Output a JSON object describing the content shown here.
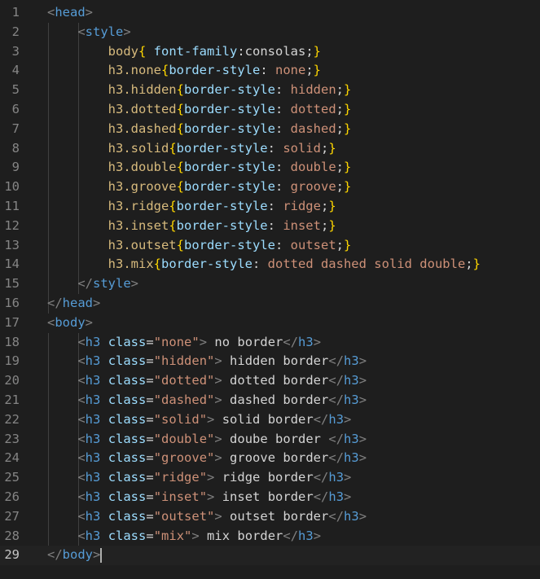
{
  "editor": {
    "lines": [
      {
        "n": "1",
        "parts": [
          [
            "punct",
            "<"
          ],
          [
            "tag",
            "head"
          ],
          [
            "punct",
            ">"
          ]
        ]
      },
      {
        "n": "2",
        "parts": [
          [
            "txt",
            "    "
          ],
          [
            "punct",
            "<"
          ],
          [
            "tag",
            "style"
          ],
          [
            "punct",
            ">"
          ]
        ]
      },
      {
        "n": "3",
        "parts": [
          [
            "txt",
            "        "
          ],
          [
            "sel",
            "body"
          ],
          [
            "brace",
            "{"
          ],
          [
            "txt",
            " "
          ],
          [
            "prop",
            "font-family"
          ],
          [
            "txt",
            ":consolas;"
          ],
          [
            "brace",
            "}"
          ]
        ]
      },
      {
        "n": "4",
        "parts": [
          [
            "txt",
            "        "
          ],
          [
            "sel",
            "h3.none"
          ],
          [
            "brace",
            "{"
          ],
          [
            "prop",
            "border-style"
          ],
          [
            "txt",
            ": "
          ],
          [
            "val",
            "none"
          ],
          [
            "txt",
            ";"
          ],
          [
            "brace",
            "}"
          ]
        ]
      },
      {
        "n": "5",
        "parts": [
          [
            "txt",
            "        "
          ],
          [
            "sel",
            "h3.hidden"
          ],
          [
            "brace",
            "{"
          ],
          [
            "prop",
            "border-style"
          ],
          [
            "txt",
            ": "
          ],
          [
            "val",
            "hidden"
          ],
          [
            "txt",
            ";"
          ],
          [
            "brace",
            "}"
          ]
        ]
      },
      {
        "n": "6",
        "parts": [
          [
            "txt",
            "        "
          ],
          [
            "sel",
            "h3.dotted"
          ],
          [
            "brace",
            "{"
          ],
          [
            "prop",
            "border-style"
          ],
          [
            "txt",
            ": "
          ],
          [
            "val",
            "dotted"
          ],
          [
            "txt",
            ";"
          ],
          [
            "brace",
            "}"
          ]
        ]
      },
      {
        "n": "7",
        "parts": [
          [
            "txt",
            "        "
          ],
          [
            "sel",
            "h3.dashed"
          ],
          [
            "brace",
            "{"
          ],
          [
            "prop",
            "border-style"
          ],
          [
            "txt",
            ": "
          ],
          [
            "val",
            "dashed"
          ],
          [
            "txt",
            ";"
          ],
          [
            "brace",
            "}"
          ]
        ]
      },
      {
        "n": "8",
        "parts": [
          [
            "txt",
            "        "
          ],
          [
            "sel",
            "h3.solid"
          ],
          [
            "brace",
            "{"
          ],
          [
            "prop",
            "border-style"
          ],
          [
            "txt",
            ": "
          ],
          [
            "val",
            "solid"
          ],
          [
            "txt",
            ";"
          ],
          [
            "brace",
            "}"
          ]
        ]
      },
      {
        "n": "9",
        "parts": [
          [
            "txt",
            "        "
          ],
          [
            "sel",
            "h3.double"
          ],
          [
            "brace",
            "{"
          ],
          [
            "prop",
            "border-style"
          ],
          [
            "txt",
            ": "
          ],
          [
            "val",
            "double"
          ],
          [
            "txt",
            ";"
          ],
          [
            "brace",
            "}"
          ]
        ]
      },
      {
        "n": "10",
        "parts": [
          [
            "txt",
            "        "
          ],
          [
            "sel",
            "h3.groove"
          ],
          [
            "brace",
            "{"
          ],
          [
            "prop",
            "border-style"
          ],
          [
            "txt",
            ": "
          ],
          [
            "val",
            "groove"
          ],
          [
            "txt",
            ";"
          ],
          [
            "brace",
            "}"
          ]
        ]
      },
      {
        "n": "11",
        "parts": [
          [
            "txt",
            "        "
          ],
          [
            "sel",
            "h3.ridge"
          ],
          [
            "brace",
            "{"
          ],
          [
            "prop",
            "border-style"
          ],
          [
            "txt",
            ": "
          ],
          [
            "val",
            "ridge"
          ],
          [
            "txt",
            ";"
          ],
          [
            "brace",
            "}"
          ]
        ]
      },
      {
        "n": "12",
        "parts": [
          [
            "txt",
            "        "
          ],
          [
            "sel",
            "h3.inset"
          ],
          [
            "brace",
            "{"
          ],
          [
            "prop",
            "border-style"
          ],
          [
            "txt",
            ": "
          ],
          [
            "val",
            "inset"
          ],
          [
            "txt",
            ";"
          ],
          [
            "brace",
            "}"
          ]
        ]
      },
      {
        "n": "13",
        "parts": [
          [
            "txt",
            "        "
          ],
          [
            "sel",
            "h3.outset"
          ],
          [
            "brace",
            "{"
          ],
          [
            "prop",
            "border-style"
          ],
          [
            "txt",
            ": "
          ],
          [
            "val",
            "outset"
          ],
          [
            "txt",
            ";"
          ],
          [
            "brace",
            "}"
          ]
        ]
      },
      {
        "n": "14",
        "parts": [
          [
            "txt",
            "        "
          ],
          [
            "sel",
            "h3.mix"
          ],
          [
            "brace",
            "{"
          ],
          [
            "prop",
            "border-style"
          ],
          [
            "txt",
            ": "
          ],
          [
            "val",
            "dotted dashed solid double"
          ],
          [
            "txt",
            ";"
          ],
          [
            "brace",
            "}"
          ]
        ]
      },
      {
        "n": "15",
        "parts": [
          [
            "txt",
            "    "
          ],
          [
            "punct",
            "</"
          ],
          [
            "tag",
            "style"
          ],
          [
            "punct",
            ">"
          ]
        ]
      },
      {
        "n": "16",
        "parts": [
          [
            "punct",
            "</"
          ],
          [
            "tag",
            "head"
          ],
          [
            "punct",
            ">"
          ]
        ]
      },
      {
        "n": "17",
        "parts": [
          [
            "punct",
            "<"
          ],
          [
            "tag",
            "body"
          ],
          [
            "punct",
            ">"
          ]
        ]
      },
      {
        "n": "18",
        "parts": [
          [
            "txt",
            "    "
          ],
          [
            "punct",
            "<"
          ],
          [
            "tag",
            "h3"
          ],
          [
            "txt",
            " "
          ],
          [
            "attr",
            "class"
          ],
          [
            "txt",
            "="
          ],
          [
            "str",
            "\"none\""
          ],
          [
            "punct",
            ">"
          ],
          [
            "txt",
            " no border"
          ],
          [
            "punct",
            "</"
          ],
          [
            "tag",
            "h3"
          ],
          [
            "punct",
            ">"
          ]
        ]
      },
      {
        "n": "19",
        "parts": [
          [
            "txt",
            "    "
          ],
          [
            "punct",
            "<"
          ],
          [
            "tag",
            "h3"
          ],
          [
            "txt",
            " "
          ],
          [
            "attr",
            "class"
          ],
          [
            "txt",
            "="
          ],
          [
            "str",
            "\"hidden\""
          ],
          [
            "punct",
            ">"
          ],
          [
            "txt",
            " hidden border"
          ],
          [
            "punct",
            "</"
          ],
          [
            "tag",
            "h3"
          ],
          [
            "punct",
            ">"
          ]
        ]
      },
      {
        "n": "20",
        "parts": [
          [
            "txt",
            "    "
          ],
          [
            "punct",
            "<"
          ],
          [
            "tag",
            "h3"
          ],
          [
            "txt",
            " "
          ],
          [
            "attr",
            "class"
          ],
          [
            "txt",
            "="
          ],
          [
            "str",
            "\"dotted\""
          ],
          [
            "punct",
            ">"
          ],
          [
            "txt",
            " dotted border"
          ],
          [
            "punct",
            "</"
          ],
          [
            "tag",
            "h3"
          ],
          [
            "punct",
            ">"
          ]
        ]
      },
      {
        "n": "21",
        "parts": [
          [
            "txt",
            "    "
          ],
          [
            "punct",
            "<"
          ],
          [
            "tag",
            "h3"
          ],
          [
            "txt",
            " "
          ],
          [
            "attr",
            "class"
          ],
          [
            "txt",
            "="
          ],
          [
            "str",
            "\"dashed\""
          ],
          [
            "punct",
            ">"
          ],
          [
            "txt",
            " dashed border"
          ],
          [
            "punct",
            "</"
          ],
          [
            "tag",
            "h3"
          ],
          [
            "punct",
            ">"
          ]
        ]
      },
      {
        "n": "22",
        "parts": [
          [
            "txt",
            "    "
          ],
          [
            "punct",
            "<"
          ],
          [
            "tag",
            "h3"
          ],
          [
            "txt",
            " "
          ],
          [
            "attr",
            "class"
          ],
          [
            "txt",
            "="
          ],
          [
            "str",
            "\"solid\""
          ],
          [
            "punct",
            ">"
          ],
          [
            "txt",
            " solid border"
          ],
          [
            "punct",
            "</"
          ],
          [
            "tag",
            "h3"
          ],
          [
            "punct",
            ">"
          ]
        ]
      },
      {
        "n": "23",
        "parts": [
          [
            "txt",
            "    "
          ],
          [
            "punct",
            "<"
          ],
          [
            "tag",
            "h3"
          ],
          [
            "txt",
            " "
          ],
          [
            "attr",
            "class"
          ],
          [
            "txt",
            "="
          ],
          [
            "str",
            "\"double\""
          ],
          [
            "punct",
            ">"
          ],
          [
            "txt",
            " doube border "
          ],
          [
            "punct",
            "</"
          ],
          [
            "tag",
            "h3"
          ],
          [
            "punct",
            ">"
          ]
        ]
      },
      {
        "n": "24",
        "parts": [
          [
            "txt",
            "    "
          ],
          [
            "punct",
            "<"
          ],
          [
            "tag",
            "h3"
          ],
          [
            "txt",
            " "
          ],
          [
            "attr",
            "class"
          ],
          [
            "txt",
            "="
          ],
          [
            "str",
            "\"groove\""
          ],
          [
            "punct",
            ">"
          ],
          [
            "txt",
            " groove border"
          ],
          [
            "punct",
            "</"
          ],
          [
            "tag",
            "h3"
          ],
          [
            "punct",
            ">"
          ]
        ]
      },
      {
        "n": "25",
        "parts": [
          [
            "txt",
            "    "
          ],
          [
            "punct",
            "<"
          ],
          [
            "tag",
            "h3"
          ],
          [
            "txt",
            " "
          ],
          [
            "attr",
            "class"
          ],
          [
            "txt",
            "="
          ],
          [
            "str",
            "\"ridge\""
          ],
          [
            "punct",
            ">"
          ],
          [
            "txt",
            " ridge border"
          ],
          [
            "punct",
            "</"
          ],
          [
            "tag",
            "h3"
          ],
          [
            "punct",
            ">"
          ]
        ]
      },
      {
        "n": "26",
        "parts": [
          [
            "txt",
            "    "
          ],
          [
            "punct",
            "<"
          ],
          [
            "tag",
            "h3"
          ],
          [
            "txt",
            " "
          ],
          [
            "attr",
            "class"
          ],
          [
            "txt",
            "="
          ],
          [
            "str",
            "\"inset\""
          ],
          [
            "punct",
            ">"
          ],
          [
            "txt",
            " inset border"
          ],
          [
            "punct",
            "</"
          ],
          [
            "tag",
            "h3"
          ],
          [
            "punct",
            ">"
          ]
        ]
      },
      {
        "n": "27",
        "parts": [
          [
            "txt",
            "    "
          ],
          [
            "punct",
            "<"
          ],
          [
            "tag",
            "h3"
          ],
          [
            "txt",
            " "
          ],
          [
            "attr",
            "class"
          ],
          [
            "txt",
            "="
          ],
          [
            "str",
            "\"outset\""
          ],
          [
            "punct",
            ">"
          ],
          [
            "txt",
            " outset border"
          ],
          [
            "punct",
            "</"
          ],
          [
            "tag",
            "h3"
          ],
          [
            "punct",
            ">"
          ]
        ]
      },
      {
        "n": "28",
        "parts": [
          [
            "txt",
            "    "
          ],
          [
            "punct",
            "<"
          ],
          [
            "tag",
            "h3"
          ],
          [
            "txt",
            " "
          ],
          [
            "attr",
            "class"
          ],
          [
            "txt",
            "="
          ],
          [
            "str",
            "\"mix\""
          ],
          [
            "punct",
            ">"
          ],
          [
            "txt",
            " mix border"
          ],
          [
            "punct",
            "</"
          ],
          [
            "tag",
            "h3"
          ],
          [
            "punct",
            ">"
          ]
        ]
      },
      {
        "n": "29",
        "parts": [
          [
            "punct",
            "</"
          ],
          [
            "tag",
            "body"
          ],
          [
            "punct",
            ">"
          ]
        ],
        "active": true
      }
    ]
  },
  "colors": {
    "background": "#1e1e1e",
    "line_number": "#858585",
    "tag": "#569cd6",
    "punctuation": "#808080",
    "selector": "#d7ba7d",
    "brace": "#ffd700",
    "property": "#9cdcfe",
    "value": "#ce9178",
    "text": "#d4d4d4"
  }
}
